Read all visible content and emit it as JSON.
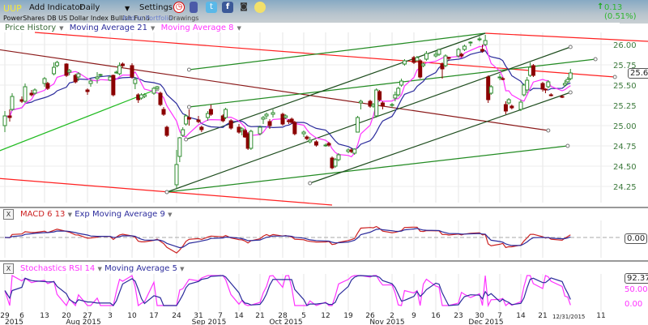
{
  "toolbar": {
    "symbol": "UUP",
    "add_indicator": "Add Indicator",
    "interval": "Daily",
    "settings": "Settings",
    "change": "0.13 (0.51%)",
    "change_color": "#2db52d",
    "icons": [
      "alarm-clock-icon",
      "books-icon",
      "twitter-icon",
      "facebook-icon",
      "camera-icon",
      "chat-icon"
    ]
  },
  "subheader": {
    "fund_name": "PowerShares DB US Dollar Index Bullish Fund",
    "add_to_portfolio": "Add to Portfolio",
    "drawings": "Drawings"
  },
  "legend": {
    "price_history": "Price History",
    "ma21": "Moving Average 21",
    "ma8": "Moving Average 8"
  },
  "macd_panel": {
    "close": "X",
    "label": "MACD 6 13",
    "signal": "Exp Moving Average 9",
    "readout": "0.00"
  },
  "stoch_panel": {
    "close": "X",
    "label": "Stochastics RSI 14",
    "signal": "Moving Average 5",
    "readout": "92.37",
    "level_50": "50.00",
    "level_0": "0.00"
  },
  "price_readout": "25.65",
  "x_axis": {
    "ticks": [
      "29",
      "6",
      "13",
      "20",
      "27",
      "3",
      "10",
      "17",
      "24",
      "31",
      "7",
      "14",
      "21",
      "28",
      "5",
      "12",
      "19",
      "26",
      "2",
      "9",
      "16",
      "23",
      "30",
      "7",
      "14",
      "21",
      "11"
    ],
    "months": [
      "2015",
      "Aug 2015",
      "Sep 2015",
      "Oct 2015",
      "Nov 2015",
      "Dec 2015"
    ],
    "current_date": "12/31/2015"
  },
  "chart_data": {
    "type": "candlestick",
    "y_ticks": [
      "26.00",
      "25.75",
      "25.50",
      "25.25",
      "25.00",
      "24.75",
      "24.50",
      "24.25"
    ],
    "ylim": [
      24.05,
      26.3
    ],
    "colors": {
      "up": "#2e8b2e",
      "down": "#8b0000",
      "ma21": "#2b2b9c",
      "ma8": "#ff33ff",
      "macd": "#cc2222",
      "stoch": "#ff33ff"
    },
    "candles": [
      [
        "2015-06-29",
        25.0,
        25.18,
        24.92,
        25.12
      ],
      [
        "2015-07-01",
        25.12,
        25.2,
        25.05,
        25.1
      ],
      [
        "2015-07-02",
        25.2,
        25.4,
        25.18,
        25.36
      ],
      [
        "2015-07-06",
        25.32,
        25.36,
        25.28,
        25.3
      ],
      [
        "2015-07-07",
        25.3,
        25.52,
        25.28,
        25.48
      ],
      [
        "2015-07-09",
        25.4,
        25.44,
        25.36,
        25.38
      ],
      [
        "2015-07-10",
        25.4,
        25.46,
        25.38,
        25.44
      ],
      [
        "2015-07-13",
        25.52,
        25.6,
        25.48,
        25.58
      ],
      [
        "2015-07-14",
        25.52,
        25.54,
        25.44,
        25.46
      ],
      [
        "2015-07-16",
        25.64,
        25.78,
        25.62,
        25.72
      ],
      [
        "2015-07-17",
        25.74,
        25.8,
        25.72,
        25.78
      ],
      [
        "2015-07-20",
        25.76,
        25.77,
        25.6,
        25.62
      ],
      [
        "2015-07-21",
        25.66,
        25.7,
        25.62,
        25.68
      ],
      [
        "2015-07-23",
        25.62,
        25.64,
        25.52,
        25.54
      ],
      [
        "2015-07-24",
        25.6,
        25.66,
        25.55,
        25.64
      ],
      [
        "2015-07-27",
        25.44,
        25.46,
        25.38,
        25.42
      ],
      [
        "2015-07-28",
        25.52,
        25.58,
        25.48,
        25.55
      ],
      [
        "2015-07-30",
        25.58,
        25.66,
        25.52,
        25.6
      ],
      [
        "2015-07-31",
        25.62,
        25.64,
        25.6,
        25.63
      ],
      [
        "2015-08-03",
        25.56,
        25.62,
        25.55,
        25.6
      ],
      [
        "2015-08-04",
        25.62,
        25.63,
        25.36,
        25.38
      ],
      [
        "2015-08-05",
        25.66,
        25.68,
        25.64,
        25.66
      ],
      [
        "2015-08-06",
        25.64,
        25.78,
        25.62,
        25.74
      ],
      [
        "2015-08-07",
        25.76,
        25.78,
        25.72,
        25.74
      ],
      [
        "2015-08-10",
        25.74,
        25.77,
        25.58,
        25.6
      ],
      [
        "2015-08-11",
        25.52,
        25.6,
        25.45,
        25.57
      ],
      [
        "2015-08-12",
        25.38,
        25.4,
        25.28,
        25.32
      ],
      [
        "2015-08-13",
        25.34,
        25.4,
        25.32,
        25.38
      ],
      [
        "2015-08-14",
        25.36,
        25.4,
        25.34,
        25.38
      ],
      [
        "2015-08-17",
        25.4,
        25.48,
        25.38,
        25.46
      ],
      [
        "2015-08-18",
        25.46,
        25.49,
        25.44,
        25.48
      ],
      [
        "2015-08-19",
        25.4,
        25.42,
        25.24,
        25.26
      ],
      [
        "2015-08-20",
        25.2,
        25.23,
        25.12,
        25.14
      ],
      [
        "2015-08-21",
        24.98,
        25.0,
        24.86,
        24.88
      ],
      [
        "2015-08-24",
        24.27,
        24.7,
        24.22,
        24.52
      ],
      [
        "2015-08-25",
        24.62,
        24.86,
        24.55,
        24.85
      ],
      [
        "2015-08-26",
        24.88,
        24.98,
        24.86,
        24.95
      ],
      [
        "2015-08-27",
        25.02,
        25.14,
        25.0,
        25.12
      ],
      [
        "2015-08-28",
        25.1,
        25.2,
        25.0,
        25.08
      ],
      [
        "2015-08-31",
        25.07,
        25.12,
        25.03,
        25.05
      ],
      [
        "2015-09-01",
        24.98,
        25.0,
        24.92,
        24.95
      ],
      [
        "2015-09-03",
        25.1,
        25.18,
        25.06,
        25.15
      ],
      [
        "2015-09-04",
        25.2,
        25.26,
        25.12,
        25.14
      ],
      [
        "2015-09-08",
        25.12,
        25.14,
        25.04,
        25.06
      ],
      [
        "2015-09-09",
        25.1,
        25.22,
        25.08,
        25.2
      ],
      [
        "2015-09-11",
        25.06,
        25.08,
        24.95,
        24.97
      ],
      [
        "2015-09-14",
        24.98,
        25.02,
        24.9,
        24.92
      ],
      [
        "2015-09-15",
        24.94,
        24.98,
        24.88,
        24.96
      ],
      [
        "2015-09-16",
        24.94,
        24.96,
        24.85,
        24.86
      ],
      [
        "2015-09-17",
        24.9,
        24.92,
        24.7,
        24.72
      ],
      [
        "2015-09-18",
        24.72,
        24.95,
        24.7,
        24.93
      ],
      [
        "2015-09-21",
        24.9,
        25.0,
        24.88,
        24.98
      ],
      [
        "2015-09-22",
        25.08,
        25.12,
        25.02,
        25.1
      ],
      [
        "2015-09-23",
        25.12,
        25.16,
        25.08,
        25.14
      ],
      [
        "2015-09-24",
        25.05,
        25.08,
        24.96,
        25.0
      ],
      [
        "2015-09-25",
        25.14,
        25.2,
        25.1,
        25.16
      ],
      [
        "2015-09-28",
        25.14,
        25.16,
        25.0,
        25.02
      ],
      [
        "2015-09-29",
        25.1,
        25.14,
        25.08,
        25.12
      ],
      [
        "2015-09-30",
        25.06,
        25.08,
        25.02,
        25.05
      ],
      [
        "2015-10-01",
        25.08,
        25.1,
        25.02,
        25.04
      ],
      [
        "2015-10-02",
        25.04,
        25.06,
        24.88,
        24.9
      ],
      [
        "2015-10-05",
        24.9,
        24.94,
        24.86,
        24.92
      ],
      [
        "2015-10-06",
        24.86,
        24.88,
        24.82,
        24.84
      ],
      [
        "2015-10-07",
        24.8,
        24.86,
        24.78,
        24.82
      ],
      [
        "2015-10-09",
        24.8,
        24.82,
        24.74,
        24.76
      ],
      [
        "2015-10-12",
        24.76,
        24.78,
        24.74,
        24.76
      ],
      [
        "2015-10-13",
        24.78,
        24.8,
        24.74,
        24.76
      ],
      [
        "2015-10-14",
        24.6,
        24.62,
        24.46,
        24.48
      ],
      [
        "2015-10-15",
        24.5,
        24.6,
        24.48,
        24.58
      ],
      [
        "2015-10-16",
        24.58,
        24.66,
        24.56,
        24.64
      ],
      [
        "2015-10-19",
        24.68,
        24.72,
        24.66,
        24.7
      ],
      [
        "2015-10-20",
        24.7,
        24.72,
        24.66,
        24.68
      ],
      [
        "2015-10-21",
        24.66,
        24.72,
        24.64,
        24.71
      ],
      [
        "2015-10-22",
        24.92,
        25.12,
        24.92,
        25.1
      ],
      [
        "2015-10-23",
        25.28,
        25.32,
        25.2,
        25.3
      ],
      [
        "2015-10-26",
        25.3,
        25.32,
        25.22,
        25.24
      ],
      [
        "2015-10-27",
        25.24,
        25.28,
        25.22,
        25.26
      ],
      [
        "2015-10-28",
        25.12,
        25.46,
        25.1,
        25.44
      ],
      [
        "2015-10-29",
        25.42,
        25.44,
        25.3,
        25.32
      ],
      [
        "2015-10-30",
        25.28,
        25.3,
        25.2,
        25.24
      ],
      [
        "2015-11-02",
        25.26,
        25.28,
        25.22,
        25.26
      ],
      [
        "2015-11-03",
        25.34,
        25.42,
        25.3,
        25.38
      ],
      [
        "2015-11-04",
        25.38,
        25.48,
        25.36,
        25.46
      ],
      [
        "2015-11-05",
        25.5,
        25.58,
        25.48,
        25.55
      ],
      [
        "2015-11-06",
        25.76,
        25.82,
        25.74,
        25.8
      ],
      [
        "2015-11-09",
        25.84,
        25.86,
        25.76,
        25.78
      ],
      [
        "2015-11-10",
        25.8,
        25.86,
        25.8,
        25.84
      ],
      [
        "2015-11-11",
        25.8,
        25.82,
        25.58,
        25.6
      ],
      [
        "2015-11-12",
        25.74,
        25.78,
        25.72,
        25.76
      ],
      [
        "2015-11-13",
        25.82,
        25.92,
        25.8,
        25.89
      ],
      [
        "2015-11-16",
        25.86,
        25.92,
        25.84,
        25.88
      ],
      [
        "2015-11-17",
        25.88,
        25.95,
        25.86,
        25.94
      ],
      [
        "2015-11-18",
        25.76,
        25.78,
        25.58,
        25.7
      ],
      [
        "2015-11-19",
        25.74,
        25.88,
        25.72,
        25.86
      ],
      [
        "2015-11-20",
        25.84,
        25.85,
        25.8,
        25.83
      ],
      [
        "2015-11-23",
        25.86,
        25.96,
        25.84,
        25.94
      ],
      [
        "2015-11-24",
        25.88,
        25.9,
        25.84,
        25.86
      ],
      [
        "2015-11-25",
        25.94,
        26.0,
        25.92,
        25.98
      ],
      [
        "2015-11-27",
        26.02,
        26.04,
        25.98,
        26.03
      ],
      [
        "2015-11-30",
        26.06,
        26.1,
        26.04,
        26.07
      ],
      [
        "2015-12-01",
        25.94,
        26.0,
        25.9,
        25.92
      ],
      [
        "2015-12-02",
        26.0,
        26.12,
        25.98,
        26.05
      ],
      [
        "2015-12-03",
        25.6,
        25.62,
        25.28,
        25.32
      ],
      [
        "2015-12-04",
        25.4,
        25.5,
        25.38,
        25.48
      ],
      [
        "2015-12-07",
        25.6,
        25.64,
        25.56,
        25.6
      ],
      [
        "2015-12-08",
        25.58,
        25.6,
        25.56,
        25.57
      ],
      [
        "2015-12-09",
        25.26,
        25.3,
        25.14,
        25.18
      ],
      [
        "2015-12-10",
        25.28,
        25.34,
        25.26,
        25.32
      ],
      [
        "2015-12-11",
        25.24,
        25.26,
        25.2,
        25.22
      ],
      [
        "2015-12-14",
        25.2,
        25.32,
        25.18,
        25.29
      ],
      [
        "2015-12-15",
        25.38,
        25.52,
        25.36,
        25.5
      ],
      [
        "2015-12-16",
        25.44,
        25.6,
        25.4,
        25.56
      ],
      [
        "2015-12-17",
        25.62,
        25.78,
        25.6,
        25.72
      ],
      [
        "2015-12-18",
        25.74,
        25.76,
        25.6,
        25.62
      ],
      [
        "2015-12-21",
        25.52,
        25.54,
        25.42,
        25.45
      ],
      [
        "2015-12-22",
        25.45,
        25.46,
        25.4,
        25.44
      ],
      [
        "2015-12-23",
        25.48,
        25.56,
        25.46,
        25.54
      ],
      [
        "2015-12-24",
        25.38,
        25.4,
        25.36,
        25.37
      ],
      [
        "2015-12-28",
        25.36,
        25.38,
        25.34,
        25.35
      ],
      [
        "2015-12-29",
        25.5,
        25.56,
        25.48,
        25.52
      ],
      [
        "2015-12-30",
        25.54,
        25.6,
        25.52,
        25.57
      ],
      [
        "2015-12-31",
        25.58,
        25.7,
        25.56,
        25.65
      ]
    ],
    "trendlines": [
      {
        "color": "#ff2020",
        "from": [
          "2015-07-10",
          26.15
        ],
        "to": [
          "2016-01-16",
          25.6
        ],
        "end_marker": true
      },
      {
        "color": "#ff2020",
        "from": [
          "2015-12-02",
          26.14
        ],
        "to": [
          "2016-01-28",
          26.04
        ],
        "end_marker": false
      },
      {
        "color": "#ff2020",
        "from": [
          "2015-06-26",
          24.35
        ],
        "to": [
          "2015-10-14",
          24.02
        ],
        "end_marker": false
      },
      {
        "color": "#8b1a1a",
        "from": [
          "2015-06-26",
          25.94
        ],
        "to": [
          "2015-12-23",
          24.94
        ],
        "end_marker": true
      },
      {
        "color": "#22bb22",
        "from": [
          "2015-06-26",
          24.68
        ],
        "to": [
          "2015-08-18",
          25.45
        ],
        "end_marker": true
      },
      {
        "color": "#228b22",
        "from": [
          "2015-08-28",
          25.69
        ],
        "to": [
          "2015-12-02",
          26.14
        ],
        "start_marker": true
      },
      {
        "color": "#228b22",
        "from": [
          "2015-08-28",
          25.23
        ],
        "to": [
          "2016-01-09",
          25.82
        ],
        "start_marker": true,
        "end_marker": true
      },
      {
        "color": "#228b22",
        "from": [
          "2015-08-21",
          24.18
        ],
        "to": [
          "2015-12-30",
          24.75
        ],
        "start_marker": true,
        "end_marker": true
      },
      {
        "color": "#1e4d1e",
        "from": [
          "2015-08-27",
          24.83
        ],
        "to": [
          "2015-12-02",
          26.14
        ],
        "start_marker": true
      },
      {
        "color": "#1e4d1e",
        "from": [
          "2015-08-21",
          24.18
        ],
        "to": [
          "2015-12-31",
          25.97
        ],
        "start_marker": true,
        "end_marker": true
      },
      {
        "color": "#1e4d1e",
        "from": [
          "2015-10-07",
          24.29
        ],
        "to": [
          "2015-12-31",
          25.41
        ],
        "start_marker": true,
        "end_marker": true
      }
    ]
  }
}
